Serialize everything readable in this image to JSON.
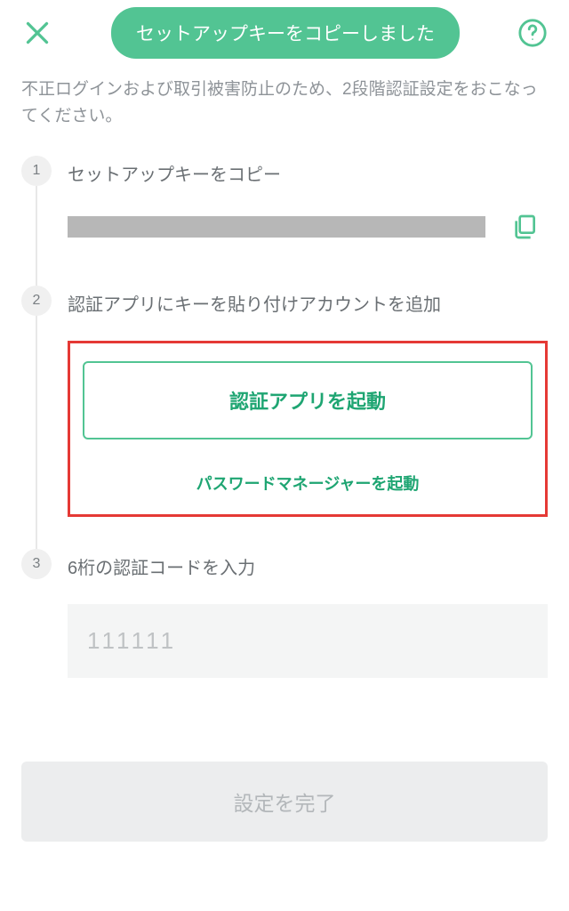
{
  "header": {
    "toast": "セットアップキーをコピーしました"
  },
  "description": "不正ログインおよび取引被害防止のため、2段階認証設定をおこなってください。",
  "steps": {
    "s1": {
      "number": "1",
      "title": "セットアップキーをコピー"
    },
    "s2": {
      "number": "2",
      "title": "認証アプリにキーを貼り付けアカウントを追加",
      "launch_app": "認証アプリを起動",
      "launch_pm": "パスワードマネージャーを起動"
    },
    "s3": {
      "number": "3",
      "title": "6桁の認証コードを入力",
      "placeholder": "111111"
    }
  },
  "submit": {
    "label": "設定を完了"
  },
  "colors": {
    "accent": "#52c493",
    "accent_text": "#1ea572",
    "highlight_border": "#e53935"
  }
}
